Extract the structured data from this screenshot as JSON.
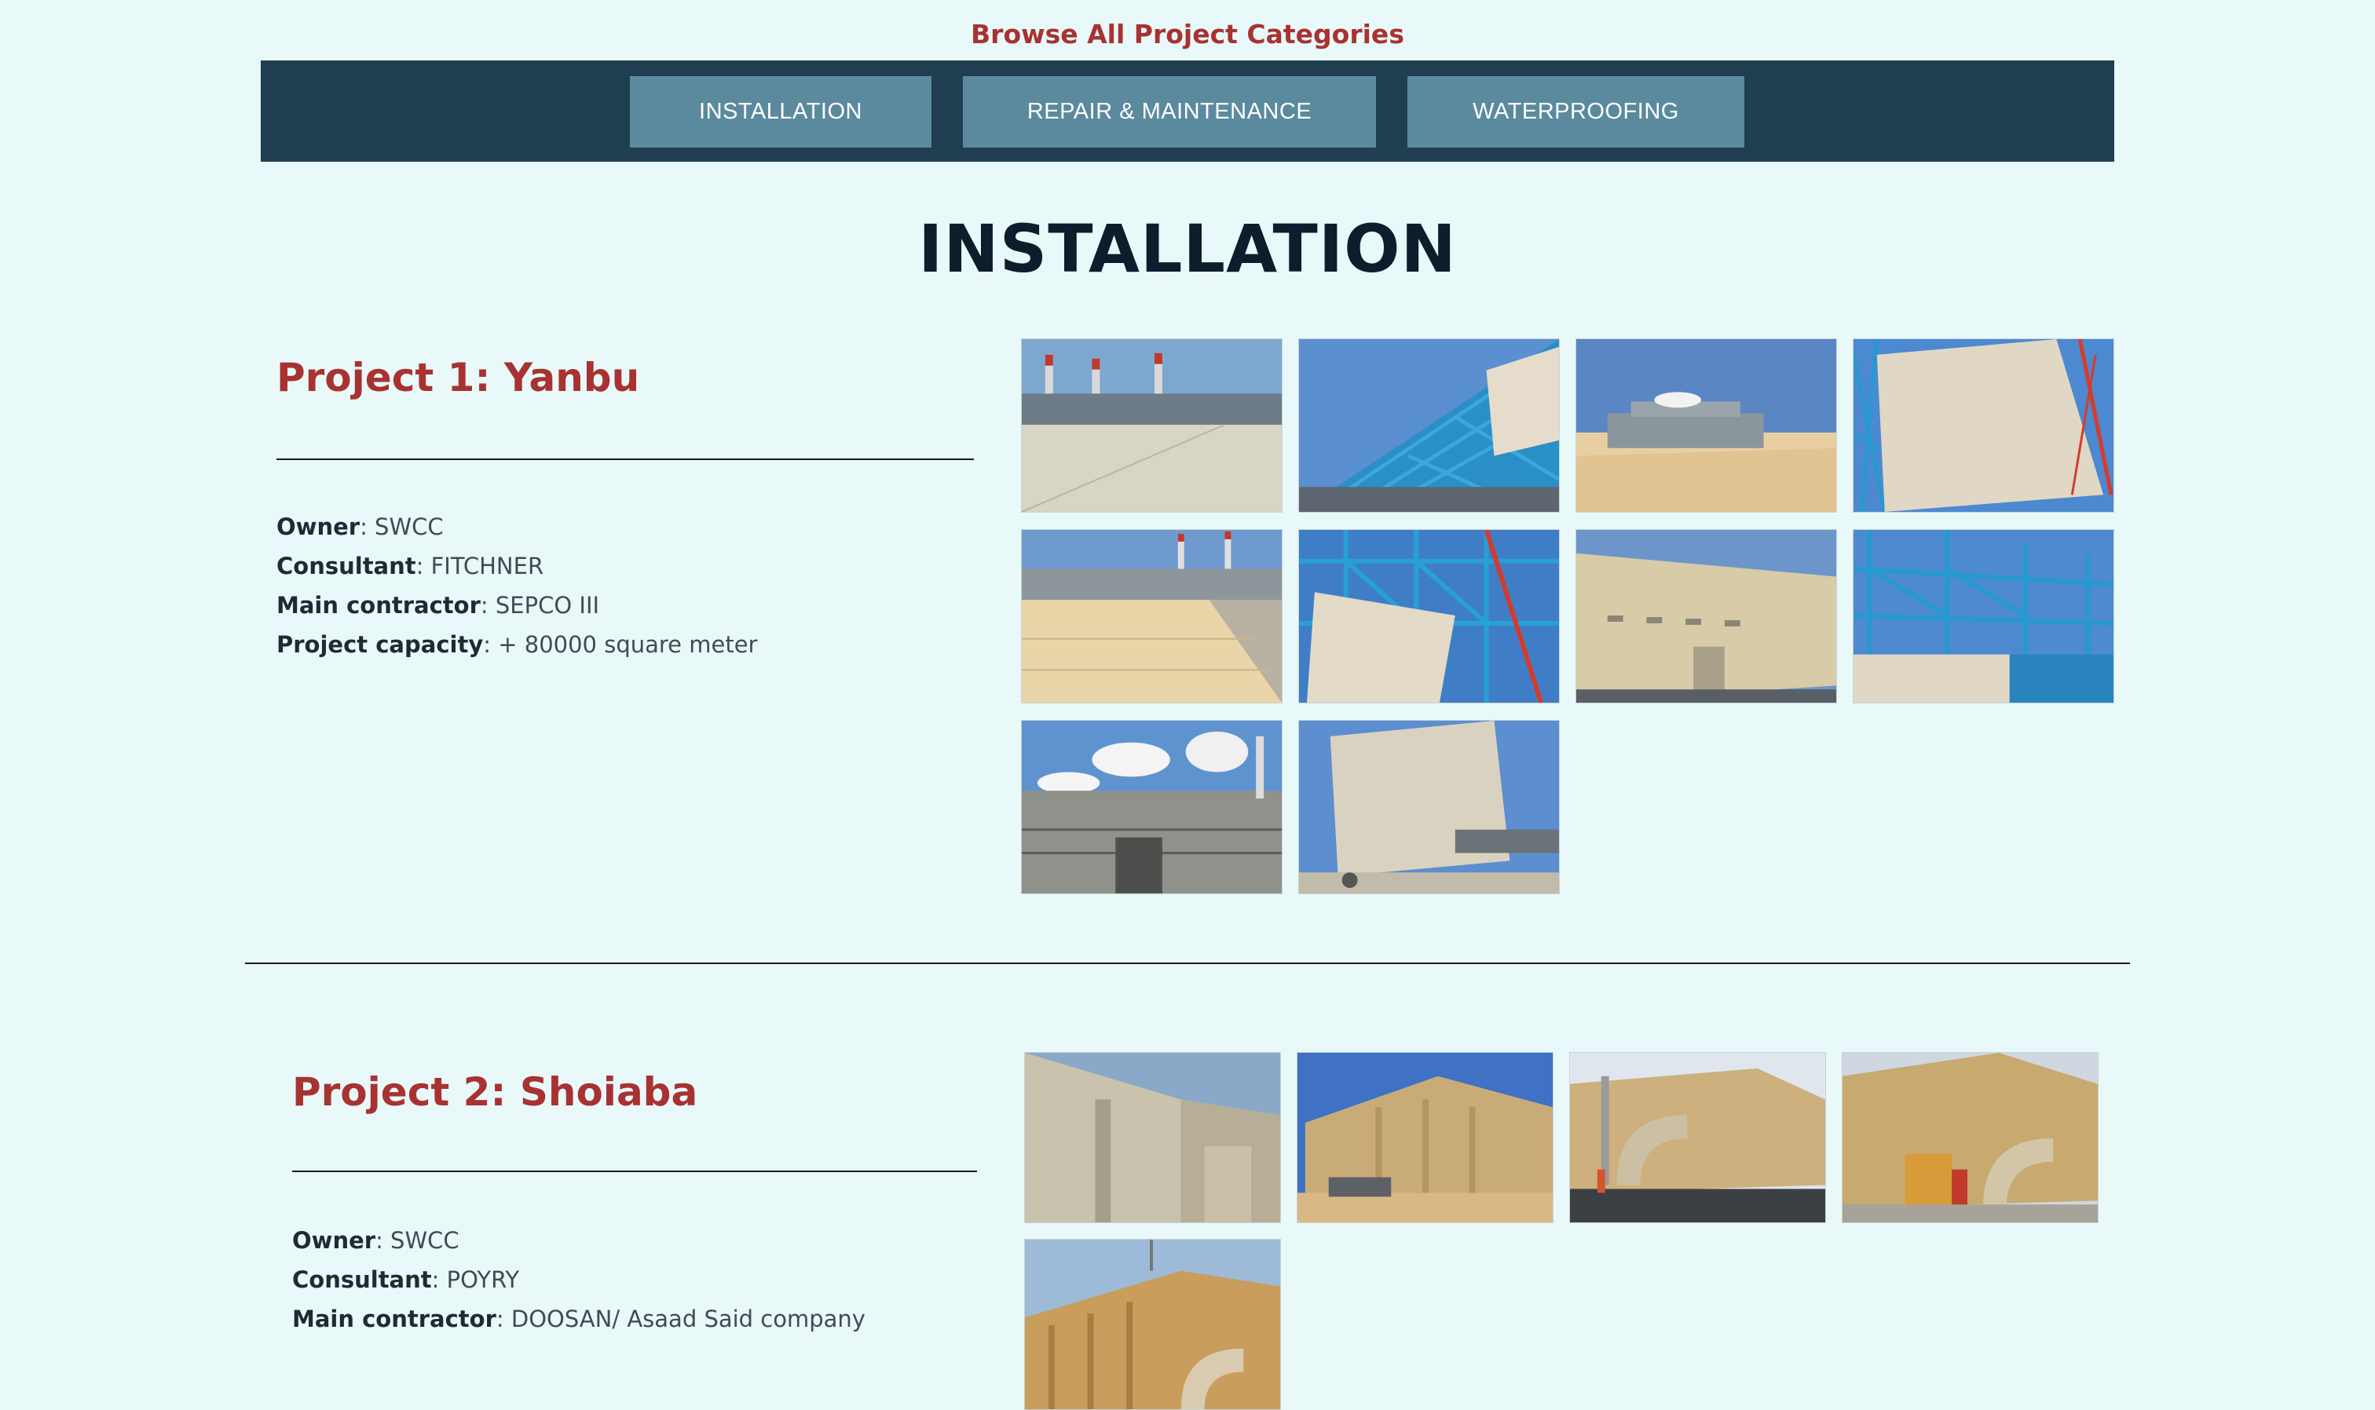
{
  "header": {
    "browse_title": "Browse All Project Categories"
  },
  "nav": {
    "tabs": [
      {
        "label": "INSTALLATION"
      },
      {
        "label": "REPAIR & MAINTENANCE"
      },
      {
        "label": "WATERPROOFING"
      }
    ]
  },
  "page_heading": "INSTALLATION",
  "projects": [
    {
      "title": "Project 1: Yanbu",
      "details": [
        {
          "label": "Owner",
          "value": ": SWCC"
        },
        {
          "label": "Consultant",
          "value": ": FITCHNER"
        },
        {
          "label": "Main contractor",
          "value": ": SEPCO III"
        },
        {
          "label": "Project capacity",
          "value": ": + 80000 square meter"
        }
      ]
    },
    {
      "title": "Project 2: Shoiaba",
      "details": [
        {
          "label": "Owner",
          "value": ": SWCC"
        },
        {
          "label": "Consultant",
          "value": ": POYRY"
        },
        {
          "label": "Main contractor",
          "value": ": DOOSAN/ Asaad Said company"
        }
      ]
    }
  ],
  "colors": {
    "background": "#e9f8f8",
    "accent_red": "#a83232",
    "nav_dark": "#1f3e4f",
    "nav_button": "#5b8a9e",
    "heading": "#0e1c2c"
  }
}
